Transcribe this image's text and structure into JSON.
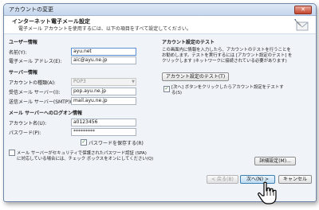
{
  "window": {
    "title": "アカウントの変更",
    "close_glyph": "✕"
  },
  "header": {
    "title": "インターネット電子メール設定",
    "subtitle": "電子メール アカウントを使用するには、以下の項目をすべて設定してください。",
    "icon": "wizard-envelope-icon"
  },
  "user_info": {
    "heading": "ユーザー情報",
    "name_label": "名前(Y):",
    "name_value": "ayu.net",
    "email_label": "電子メール アドレス(E):",
    "email_value": "aic@ayu.ne.jp"
  },
  "server_info": {
    "heading": "サーバー情報",
    "account_type_label": "アカウントの種類(A):",
    "account_type_value": "POP3",
    "incoming_label": "受信メール サーバー(I):",
    "incoming_value": "pop.ayu.ne.jp",
    "outgoing_label": "送信メール サーバー(SMTP)(O):",
    "outgoing_value": "mail.ayu.ne.jp"
  },
  "logon_info": {
    "heading": "メール サーバーへのログオン情報",
    "account_label": "アカウント名(U):",
    "account_value": "a0123456",
    "password_label": "パスワード(P):",
    "password_value": "*********",
    "remember_label": "パスワードを保存する(R)",
    "remember_checked": "✓",
    "spa_label_1": "メール サーバーがセキュリティで保護されたパスワード認証 (SPA)",
    "spa_label_2": "に対応している場合には、チェック ボックスをオンにしてください(Q)"
  },
  "test": {
    "heading": "アカウント設定のテスト",
    "desc_1": "この画面内に情報を入力したら、アカウントのテストを行うことを",
    "desc_2": "お勧めします。テストを実行するには [アカウント設定のテスト] を",
    "desc_3": "クリックします (ネットワークに接続されている必要があります)",
    "button": "アカウント設定のテスト(T)",
    "auto_check": "✓",
    "auto_label_1": "[次へ] ボタンをクリックしたらアカウント設定をテストす",
    "auto_label_2": "る(S)"
  },
  "more_settings": "詳細設定(M)...",
  "footer": {
    "back": "< 戻る(B)",
    "next": "次へ(N) >",
    "cancel": "キャンセル"
  },
  "cursor_icon": "hand-pointer-icon"
}
